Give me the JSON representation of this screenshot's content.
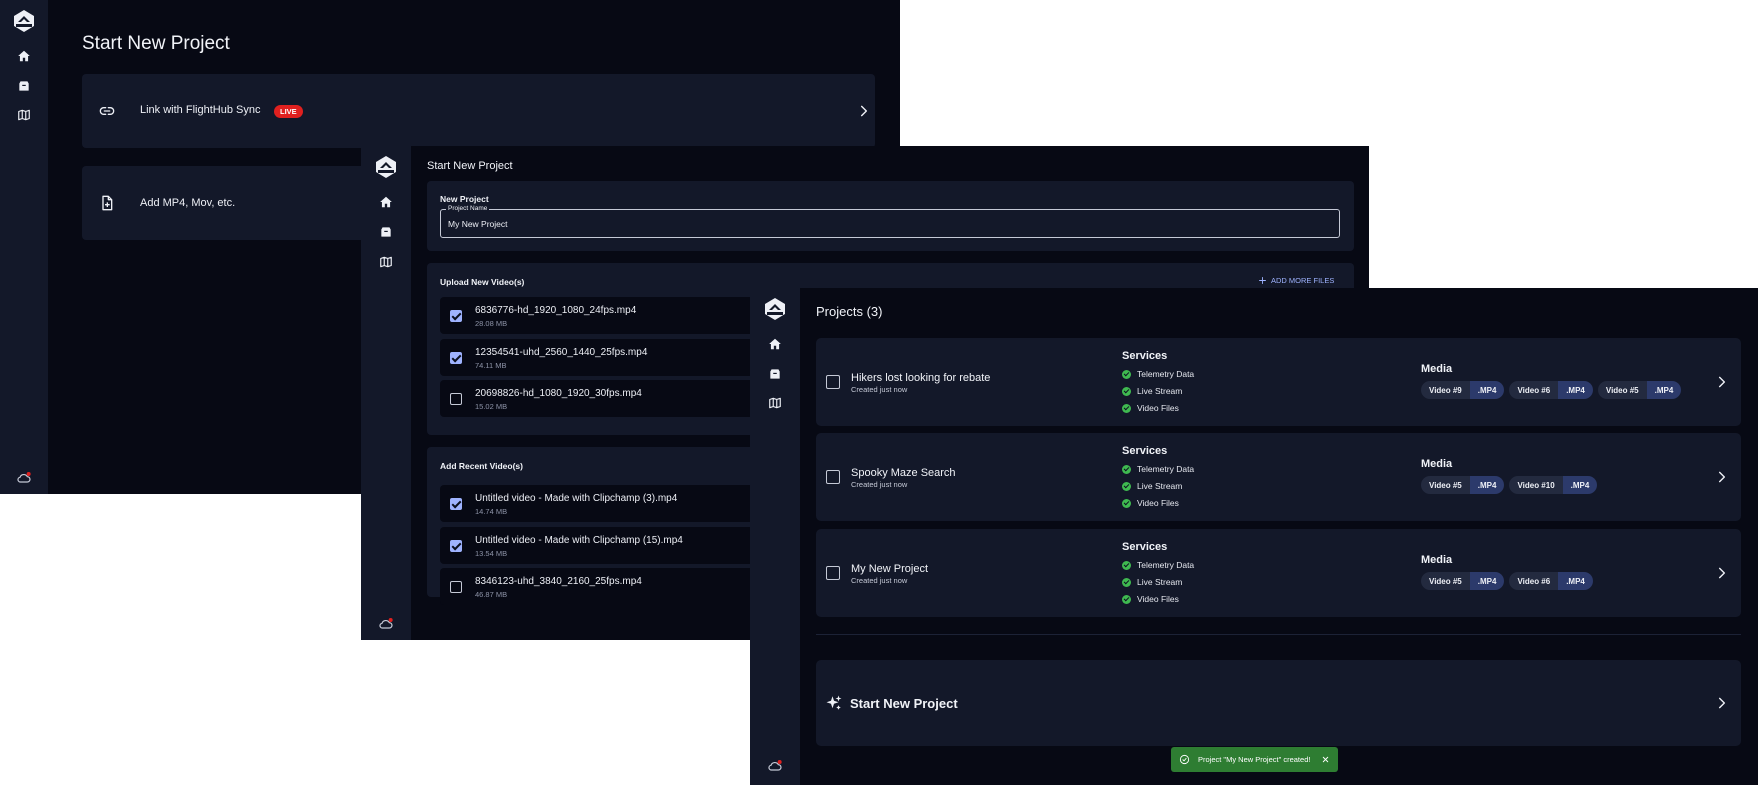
{
  "colors": {
    "background": "#070914",
    "rail": "#131829",
    "card": "#131829",
    "accent": "#9fb3ff",
    "live_badge": "#e0201f",
    "status_ok": "#3fb950",
    "toast_bg": "#2e7d32"
  },
  "win1": {
    "title": "Start New Project",
    "options": [
      {
        "icon": "link-icon",
        "label": "Link with FlightHub Sync",
        "badge": "LIVE"
      },
      {
        "icon": "file-add-icon",
        "label": "Add MP4, Mov, etc."
      }
    ]
  },
  "win2": {
    "title": "Start New Project",
    "new_project": {
      "heading": "New Project",
      "field_label": "Project Name",
      "value": "My New Project"
    },
    "upload": {
      "heading": "Upload New Video(s)",
      "add_more": "ADD MORE FILES",
      "files": [
        {
          "name": "6836776-hd_1920_1080_24fps.mp4",
          "size": "28.08 MB",
          "checked": true
        },
        {
          "name": "12354541-uhd_2560_1440_25fps.mp4",
          "size": "74.11 MB",
          "checked": true
        },
        {
          "name": "20698826-hd_1080_1920_30fps.mp4",
          "size": "15.02 MB",
          "checked": false
        }
      ]
    },
    "recent": {
      "heading": "Add Recent Video(s)",
      "files": [
        {
          "name": "Untitled video - Made with Clipchamp (3).mp4",
          "size": "14.74 MB",
          "checked": true
        },
        {
          "name": "Untitled video - Made with Clipchamp (15).mp4",
          "size": "13.54 MB",
          "checked": true
        },
        {
          "name": "8346123-uhd_3840_2160_25fps.mp4",
          "size": "46.87 MB",
          "checked": false
        }
      ]
    }
  },
  "win3": {
    "title": "Projects (3)",
    "services_heading": "Services",
    "media_heading": "Media",
    "projects": [
      {
        "name": "Hikers lost looking for rebate",
        "created": "Created just now",
        "services": [
          "Telemetry Data",
          "Live Stream",
          "Video Files"
        ],
        "media": [
          {
            "name": "Video #9",
            "ext": ".MP4"
          },
          {
            "name": "Video #6",
            "ext": ".MP4"
          },
          {
            "name": "Video #5",
            "ext": ".MP4"
          }
        ]
      },
      {
        "name": "Spooky Maze Search",
        "created": "Created just now",
        "services": [
          "Telemetry Data",
          "Live Stream",
          "Video Files"
        ],
        "media": [
          {
            "name": "Video #5",
            "ext": ".MP4"
          },
          {
            "name": "Video #10",
            "ext": ".MP4"
          }
        ]
      },
      {
        "name": "My New Project",
        "created": "Created just now",
        "services": [
          "Telemetry Data",
          "Live Stream",
          "Video Files"
        ],
        "media": [
          {
            "name": "Video #5",
            "ext": ".MP4"
          },
          {
            "name": "Video #6",
            "ext": ".MP4"
          }
        ]
      }
    ],
    "start_new": "Start New Project",
    "toast": "Project \"My New Project\" created!"
  }
}
